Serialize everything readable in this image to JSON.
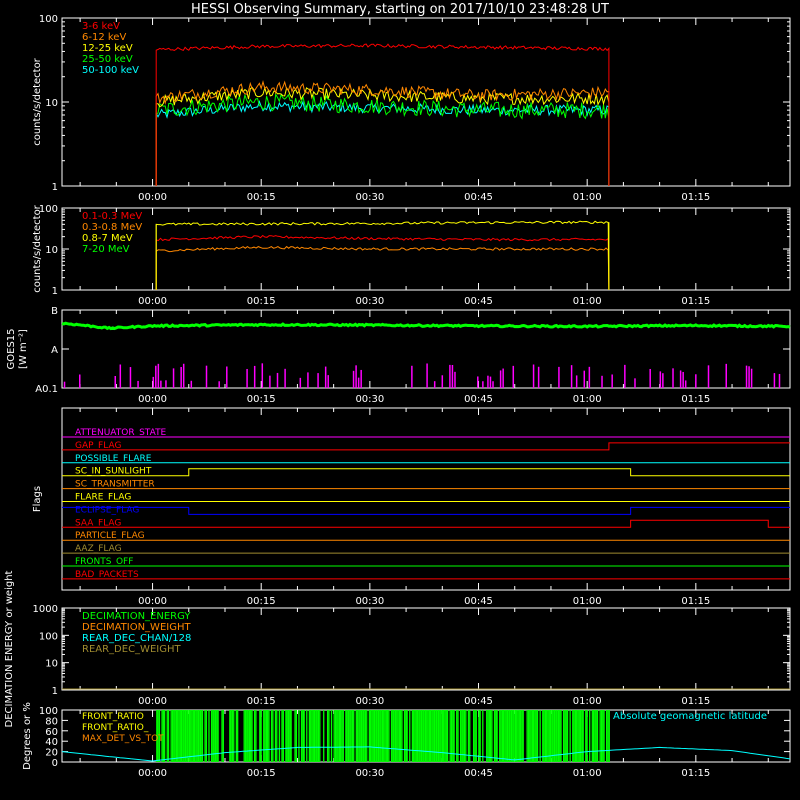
{
  "title": "HESSI Observing Summary, starting on 2017/10/10 23:48:28 UT",
  "time_ticks": [
    "00:00",
    "00:15",
    "00:30",
    "00:45",
    "01:00",
    "01:15"
  ],
  "colors": {
    "background": "#000000",
    "axes": "#ffffff",
    "red": "#ff0000",
    "orange": "#ff8800",
    "yellow": "#ffff00",
    "green": "#00ff00",
    "cyan": "#00ffff",
    "magenta": "#ff00ff",
    "blue": "#0000ff",
    "olive": "#a08c30"
  },
  "chart_data": [
    {
      "type": "line",
      "panel": "hessi-count-rates",
      "ylabel": "counts/s/detector",
      "yscale": "log",
      "ylim": [
        1,
        100
      ],
      "ytick_labels": [
        "1",
        "10",
        "100"
      ],
      "x_unit": "minutes after 00:00 UT",
      "xlim": [
        -12.5,
        88
      ],
      "data_interval": [
        0.5,
        63
      ],
      "legend_placement": "top-left",
      "series": [
        {
          "name": "3-6 keV",
          "color": "#ff0000",
          "x": [
            0.5,
            15,
            30,
            45,
            63
          ],
          "values": [
            42,
            46,
            47,
            45,
            43
          ]
        },
        {
          "name": "6-12 keV",
          "color": "#ff8800",
          "x": [
            0.5,
            15,
            30,
            45,
            63
          ],
          "values": [
            11,
            15,
            14,
            12,
            13
          ]
        },
        {
          "name": "12-25 keV",
          "color": "#ffff00",
          "x": [
            0.5,
            15,
            30,
            45,
            63
          ],
          "values": [
            10,
            13,
            12,
            11,
            11
          ]
        },
        {
          "name": "25-50 keV",
          "color": "#00ff00",
          "x": [
            0.5,
            15,
            30,
            45,
            63
          ],
          "values": [
            8,
            10,
            9,
            8,
            8
          ]
        },
        {
          "name": "50-100 keV",
          "color": "#00ffff",
          "x": [
            0.5,
            15,
            30,
            45,
            63
          ],
          "values": [
            7,
            9,
            8.5,
            8,
            8
          ]
        }
      ]
    },
    {
      "type": "line",
      "panel": "hessi-high-energy",
      "ylabel": "counts/s/detector",
      "yscale": "log",
      "ylim": [
        1,
        100
      ],
      "ytick_labels": [
        "1",
        "10",
        "100"
      ],
      "x_unit": "minutes after 00:00 UT",
      "xlim": [
        -12.5,
        88
      ],
      "data_interval": [
        0.5,
        63
      ],
      "legend_placement": "top-left",
      "series": [
        {
          "name": "0.1-0.3 MeV",
          "color": "#ff0000",
          "x": [
            0.5,
            15,
            30,
            45,
            63
          ],
          "values": [
            17,
            20,
            18,
            17,
            17
          ]
        },
        {
          "name": "0.3-0.8 MeV",
          "color": "#ff8800",
          "x": [
            0.5,
            15,
            30,
            45,
            63
          ],
          "values": [
            9,
            11,
            10,
            10,
            10
          ]
        },
        {
          "name": "0.8-7 MeV",
          "color": "#ffff00",
          "x": [
            0.5,
            15,
            30,
            45,
            63
          ],
          "values": [
            40,
            41,
            42,
            44,
            45
          ]
        },
        {
          "name": "7-20 MeV",
          "color": "#00ff00",
          "x": [
            0.5,
            15,
            30,
            45,
            63
          ],
          "values": [
            1,
            1,
            1,
            1,
            1
          ]
        }
      ]
    },
    {
      "type": "line",
      "panel": "goes15",
      "ylabel": "GOES15",
      "unit_label": "[W m⁻²]",
      "yscale": "log",
      "ytick_labels": [
        "A0.1",
        "A",
        "B"
      ],
      "ylim": [
        1e-09,
        1e-07
      ],
      "x_unit": "minutes after 00:00 UT",
      "xlim": [
        -12.5,
        88
      ],
      "series": [
        {
          "name": "",
          "color": "#00ff00",
          "x": [
            -12,
            -6,
            0,
            15,
            30,
            45,
            60,
            75,
            88
          ],
          "values": [
            4.5e-08,
            3.4e-08,
            3.9e-08,
            4.2e-08,
            4.1e-08,
            3.9e-08,
            3.8e-08,
            4e-08,
            3.8e-08
          ]
        }
      ],
      "spike_color": "#ff00ff"
    },
    {
      "type": "table",
      "panel": "flags",
      "ylabel": "Flags",
      "x_unit": "minutes after 00:00 UT",
      "xlim": [
        -12.5,
        88
      ],
      "rows": [
        {
          "label": "ATTENUATOR_STATE",
          "color": "#ff00ff",
          "steps": [
            [
              -12.5,
              0
            ]
          ]
        },
        {
          "label": "GAP_FLAG",
          "color": "#ff0000",
          "steps": [
            [
              -12.5,
              0
            ],
            [
              63,
              1
            ]
          ]
        },
        {
          "label": "POSSIBLE_FLARE",
          "color": "#00ffff",
          "steps": [
            [
              -12.5,
              0
            ]
          ]
        },
        {
          "label": "SC_IN_SUNLIGHT",
          "color": "#ffff00",
          "steps": [
            [
              -12.5,
              0
            ],
            [
              5,
              1
            ],
            [
              66,
              0
            ]
          ]
        },
        {
          "label": "SC_TRANSMITTER",
          "color": "#ff8800",
          "steps": [
            [
              -12.5,
              0
            ]
          ]
        },
        {
          "label": "FLARE_FLAG",
          "color": "#ffff00",
          "steps": [
            [
              -12.5,
              0
            ]
          ]
        },
        {
          "label": "ECLIPSE_FLAG",
          "color": "#0000ff",
          "steps": [
            [
              -12.5,
              1
            ],
            [
              5,
              0
            ],
            [
              66,
              1
            ]
          ]
        },
        {
          "label": "SAA_FLAG",
          "color": "#ff0000",
          "steps": [
            [
              -12.5,
              0
            ],
            [
              66,
              1
            ],
            [
              85,
              0
            ]
          ]
        },
        {
          "label": "PARTICLE_FLAG",
          "color": "#ff8800",
          "steps": [
            [
              -12.5,
              0
            ]
          ]
        },
        {
          "label": "AAZ_FLAG",
          "color": "#a08c30",
          "steps": [
            [
              -12.5,
              0
            ]
          ]
        },
        {
          "label": "FRONTS_OFF",
          "color": "#00ff00",
          "steps": [
            [
              -12.5,
              0
            ]
          ]
        },
        {
          "label": "BAD_PACKETS",
          "color": "#ff0000",
          "steps": [
            [
              -12.5,
              0
            ]
          ]
        }
      ]
    },
    {
      "type": "line",
      "panel": "decimation",
      "ylabel": "DECIMATION ENERGY or weight",
      "yscale": "log",
      "ylim": [
        1,
        1000
      ],
      "ytick_labels": [
        "1",
        "10",
        "100",
        "1000"
      ],
      "x_unit": "minutes after 00:00 UT",
      "xlim": [
        -12.5,
        88
      ],
      "legend_placement": "top-left",
      "series": [
        {
          "name": "DECIMATION_ENERGY",
          "color": "#00ff00",
          "x": [
            -12.5,
            88
          ],
          "values": [
            1,
            1
          ]
        },
        {
          "name": "DECIMATION_WEIGHT",
          "color": "#ff8800",
          "x": [
            -12.5,
            88
          ],
          "values": [
            1,
            1
          ]
        },
        {
          "name": "REAR_DEC_CHAN/128",
          "color": "#00ffff",
          "x": [
            -12.5,
            88
          ],
          "values": [
            1,
            1
          ]
        },
        {
          "name": "REAR_DEC_WEIGHT",
          "color": "#a08c30",
          "x": [
            -12.5,
            88
          ],
          "values": [
            1,
            1
          ]
        }
      ]
    },
    {
      "type": "line",
      "panel": "ratios",
      "ylabel": "Degrees or %",
      "ylim": [
        0,
        100
      ],
      "ytick_labels": [
        "0",
        "20",
        "40",
        "60",
        "80",
        "100"
      ],
      "x_unit": "minutes after 00:00 UT",
      "xlim": [
        -12.5,
        88
      ],
      "legend_placement": "top-left",
      "legend_entries": [
        "FRONT_RATIO",
        "FRONT_RATIO_",
        "MAX_DET_VS_TOT"
      ],
      "series": [
        {
          "name": "Absolute geomagnetic latitude",
          "color": "#00ffff",
          "x": [
            -12.5,
            -5,
            0,
            10,
            20,
            30,
            40,
            50,
            60,
            70,
            80,
            88
          ],
          "values": [
            20,
            9,
            2,
            18,
            28,
            29,
            18,
            4,
            20,
            28,
            22,
            6
          ]
        }
      ],
      "bar_fill_interval": [
        0.5,
        63
      ],
      "bar_fill_color": "#00ff00"
    }
  ]
}
